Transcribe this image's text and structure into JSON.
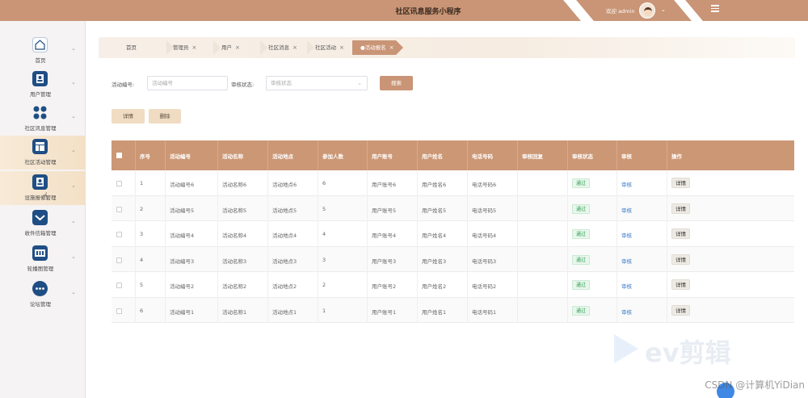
{
  "header": {
    "title": "社区讯息服务小程序",
    "welcome": "欢迎 admin",
    "accent": "#c99576"
  },
  "sidebar": {
    "items": [
      {
        "label": "首页",
        "icon": "home-icon"
      },
      {
        "label": "用户管理",
        "icon": "user-icon"
      },
      {
        "label": "社区讯息管理",
        "icon": "grid-icon"
      },
      {
        "label": "社区活动管理",
        "icon": "layout-icon"
      },
      {
        "label": "设施报修管理",
        "icon": "user-card-icon"
      },
      {
        "label": "收件信箱管理",
        "icon": "mail-icon"
      },
      {
        "label": "轮播图管理",
        "icon": "image-icon"
      },
      {
        "label": "论坛管理",
        "icon": "more-icon"
      }
    ]
  },
  "breadcrumb": {
    "items": [
      "首页",
      "管理员",
      "用户",
      "社区消息",
      "社区活动",
      "●活动报名"
    ]
  },
  "search": {
    "activity_no_label": "活动编号:",
    "activity_no_placeholder": "活动编号",
    "audit_status_label": "审核状态:",
    "audit_status_placeholder": "审核状态",
    "search_button": "搜索"
  },
  "actions": {
    "detail_button": "详情",
    "delete_button": "删除"
  },
  "table": {
    "headers": [
      "序号",
      "活动编号",
      "活动名称",
      "活动地点",
      "参加人数",
      "用户账号",
      "用户姓名",
      "电话号码",
      "审核回复",
      "审核状态",
      "审核",
      "操作"
    ],
    "rows": [
      {
        "no": "1",
        "code": "活动编号6",
        "name": "活动名称6",
        "place": "活动地点6",
        "count": "6",
        "account": "用户账号6",
        "uname": "用户姓名6",
        "phone": "电话号码6",
        "reply": "",
        "status": "通过",
        "audit": "审核",
        "op": "详情"
      },
      {
        "no": "2",
        "code": "活动编号5",
        "name": "活动名称5",
        "place": "活动地点5",
        "count": "5",
        "account": "用户账号5",
        "uname": "用户姓名5",
        "phone": "电话号码5",
        "reply": "",
        "status": "通过",
        "audit": "审核",
        "op": "详情"
      },
      {
        "no": "3",
        "code": "活动编号4",
        "name": "活动名称4",
        "place": "活动地点4",
        "count": "4",
        "account": "用户账号4",
        "uname": "用户姓名4",
        "phone": "电话号码4",
        "reply": "",
        "status": "通过",
        "audit": "审核",
        "op": "详情"
      },
      {
        "no": "4",
        "code": "活动编号3",
        "name": "活动名称3",
        "place": "活动地点3",
        "count": "3",
        "account": "用户账号3",
        "uname": "用户姓名3",
        "phone": "电话号码3",
        "reply": "",
        "status": "通过",
        "audit": "审核",
        "op": "详情"
      },
      {
        "no": "5",
        "code": "活动编号2",
        "name": "活动名称2",
        "place": "活动地点2",
        "count": "2",
        "account": "用户账号2",
        "uname": "用户姓名2",
        "phone": "电话号码2",
        "reply": "",
        "status": "通过",
        "audit": "审核",
        "op": "详情"
      },
      {
        "no": "6",
        "code": "活动编号1",
        "name": "活动名称1",
        "place": "活动地点1",
        "count": "1",
        "account": "用户账号1",
        "uname": "用户姓名1",
        "phone": "电话号码1",
        "reply": "",
        "status": "通过",
        "audit": "审核",
        "op": "详情"
      }
    ]
  },
  "watermarks": {
    "ev": "ev剪辑",
    "csdn": "CSDN @计算机YiDian"
  }
}
